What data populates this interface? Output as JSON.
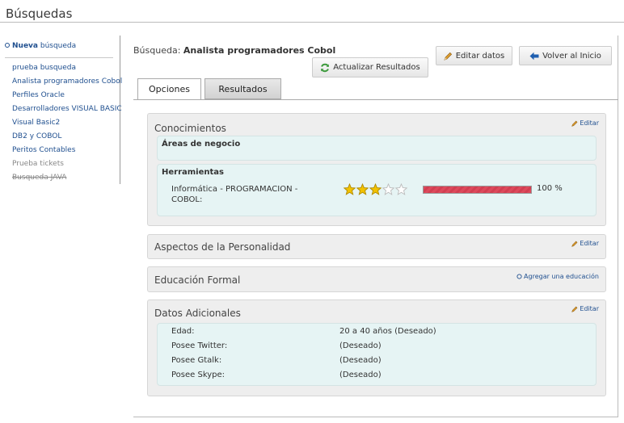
{
  "page": {
    "title": "Búsquedas"
  },
  "sidebar": {
    "new_strong": "Nueva",
    "new_rest": "búsqueda",
    "items": [
      {
        "label": "prueba busqueda",
        "style": "link"
      },
      {
        "label": "Analista programadores Cobol",
        "style": "link"
      },
      {
        "label": "Perfiles Oracle",
        "style": "link"
      },
      {
        "label": "Desarrolladores VISUAL BASIC",
        "style": "link"
      },
      {
        "label": "Visual Basic2",
        "style": "link"
      },
      {
        "label": "DB2 y COBOL",
        "style": "link"
      },
      {
        "label": "Peritos Contables",
        "style": "link"
      },
      {
        "label": "Prueba tickets",
        "style": "muted"
      },
      {
        "label": "Busqueda JAVA",
        "style": "strike"
      }
    ]
  },
  "main": {
    "search_prefix": "Búsqueda:",
    "search_name": "Analista programadores Cobol",
    "buttons": {
      "edit": "Editar datos",
      "back": "Volver al Inicio",
      "refresh": "Actualizar Resultados"
    },
    "tabs": [
      {
        "label": "Opciones",
        "active": true
      },
      {
        "label": "Resultados",
        "active": false
      }
    ],
    "panels": {
      "conocimientos": {
        "title": "Conocimientos",
        "action": "Editar",
        "areas_title": "Áreas de negocio",
        "herramientas_title": "Herramientas",
        "skill": {
          "name": "Informática - PROGRAMACION - COBOL:",
          "stars": 3,
          "max_stars": 5,
          "progress": 1.0,
          "percent_label": "100 %"
        }
      },
      "personalidad": {
        "title": "Aspectos de la Personalidad",
        "action": "Editar"
      },
      "educacion": {
        "title": "Educación Formal",
        "action": "Agregar una educación"
      },
      "datos": {
        "title": "Datos Adicionales",
        "action": "Editar",
        "rows": [
          {
            "label": "Edad:",
            "value": "20 a 40 años (Deseado)"
          },
          {
            "label": "Posee Twitter:",
            "value": "(Deseado)"
          },
          {
            "label": "Posee Gtalk:",
            "value": "(Deseado)"
          },
          {
            "label": "Posee Skype:",
            "value": "(Deseado)"
          }
        ]
      }
    }
  },
  "colors": {
    "link": "#1f4f8f",
    "bar": "#dd4a5c",
    "star_fill": "#f2c200",
    "subbox_bg": "#e6f4f4"
  }
}
